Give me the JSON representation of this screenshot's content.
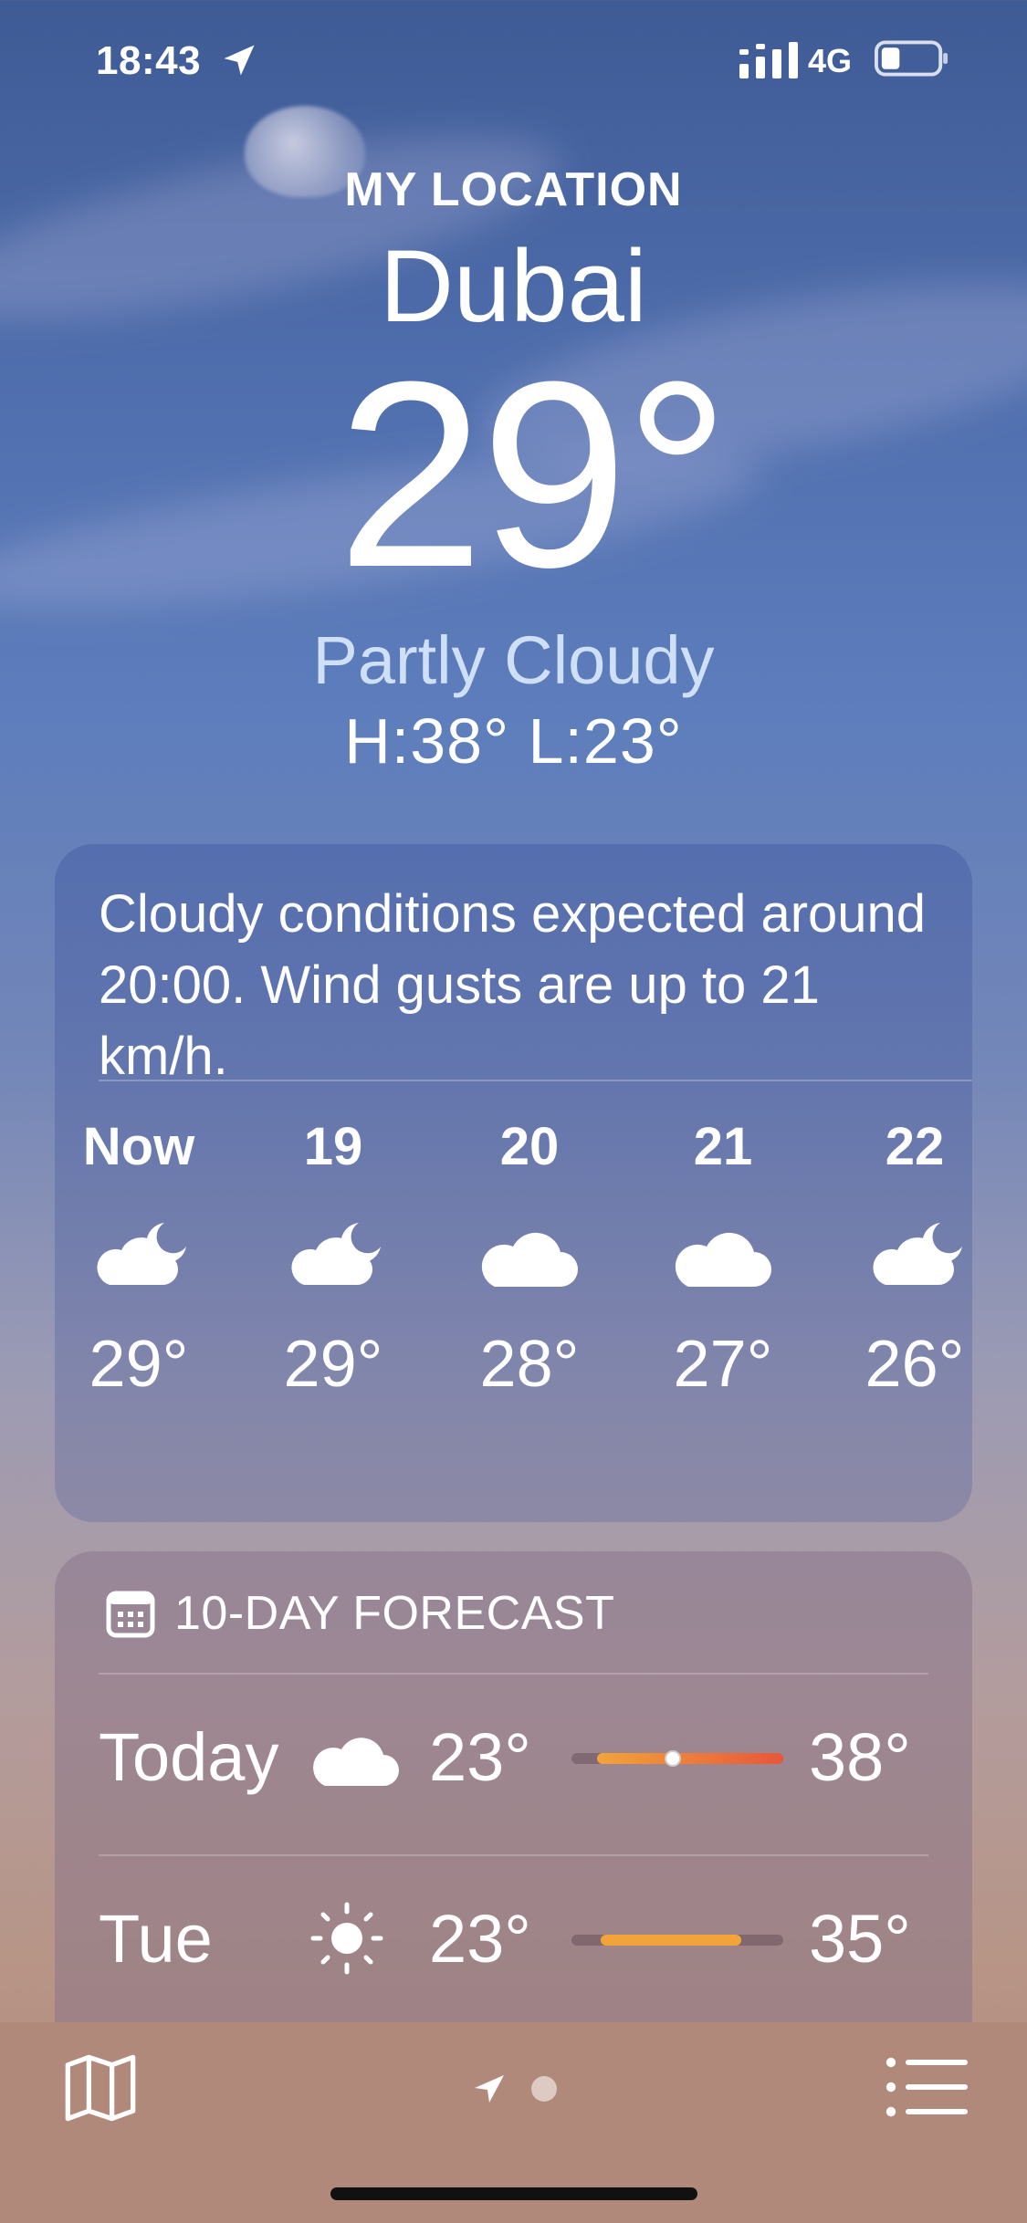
{
  "status_bar": {
    "time": "18:43",
    "network": "4G"
  },
  "header": {
    "label": "MY LOCATION",
    "city": "Dubai",
    "temperature": "29°",
    "condition": "Partly Cloudy",
    "high_low": "H:38°  L:23°"
  },
  "hourly": {
    "summary": "Cloudy conditions expected around 20:00. Wind gusts are up to 21 km/h.",
    "hours": [
      {
        "label": "Now",
        "icon": "partly-cloudy-night-icon",
        "temp": "29°"
      },
      {
        "label": "19",
        "icon": "partly-cloudy-night-icon",
        "temp": "29°"
      },
      {
        "label": "20",
        "icon": "cloud-icon",
        "temp": "28°"
      },
      {
        "label": "21",
        "icon": "cloud-icon",
        "temp": "27°"
      },
      {
        "label": "22",
        "icon": "partly-cloudy-night-icon",
        "temp": "26°"
      }
    ]
  },
  "forecast": {
    "title": "10-DAY FORECAST",
    "days": [
      {
        "name": "Today",
        "icon": "cloud-icon",
        "low": "23°",
        "high": "38°",
        "range_start": 0.12,
        "range_end": 1.0,
        "current": 0.48
      },
      {
        "name": "Tue",
        "icon": "sun-icon",
        "low": "23°",
        "high": "35°",
        "range_start": 0.14,
        "range_end": 0.8
      }
    ]
  },
  "colors": {
    "bar_warm": "#f2a43a",
    "bar_hot": "#e8563a",
    "condition_text": "#cfe0f6"
  }
}
